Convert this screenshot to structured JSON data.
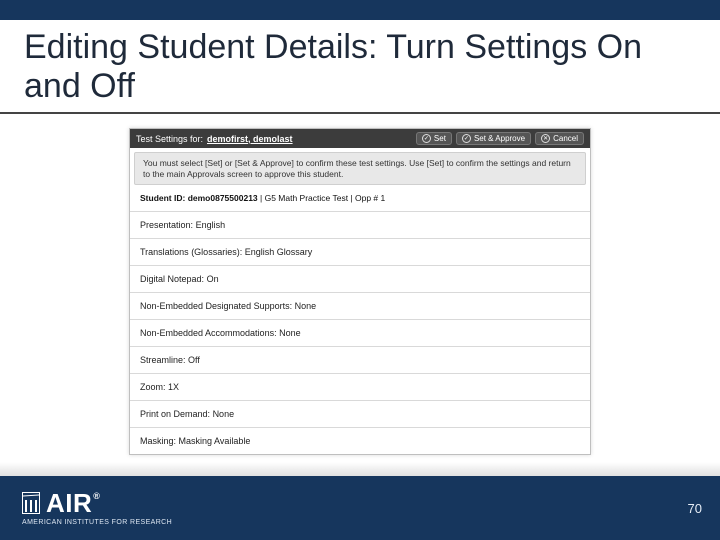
{
  "slide": {
    "title": "Editing Student Details: Turn Settings On and Off"
  },
  "dialog": {
    "header_prefix": "Test Settings for:",
    "student_name": "demofirst, demolast",
    "buttons": {
      "set": "Set",
      "set_approve": "Set & Approve",
      "cancel": "Cancel"
    },
    "instruction": "You must select [Set] or [Set & Approve] to confirm these test settings. Use [Set] to confirm the settings and return to the main Approvals screen to approve this student.",
    "id_label": "Student ID:",
    "id_value": "demo0875500213",
    "test_info": "| G5 Math Practice Test | Opp # 1",
    "rows": [
      {
        "label": "Presentation:",
        "value": "English"
      },
      {
        "label": "Translations (Glossaries):",
        "value": "English Glossary"
      },
      {
        "label": "Digital Notepad:",
        "value": "On"
      },
      {
        "label": "Non-Embedded Designated Supports:",
        "value": "None"
      },
      {
        "label": "Non-Embedded Accommodations:",
        "value": "None"
      },
      {
        "label": "Streamline:",
        "value": "Off"
      },
      {
        "label": "Zoom:",
        "value": "1X"
      },
      {
        "label": "Print on Demand:",
        "value": "None"
      },
      {
        "label": "Masking:",
        "value": "Masking Available"
      }
    ]
  },
  "footer": {
    "logo_text": "AIR",
    "logo_subtext": "AMERICAN INSTITUTES FOR RESEARCH",
    "page_number": "70"
  }
}
